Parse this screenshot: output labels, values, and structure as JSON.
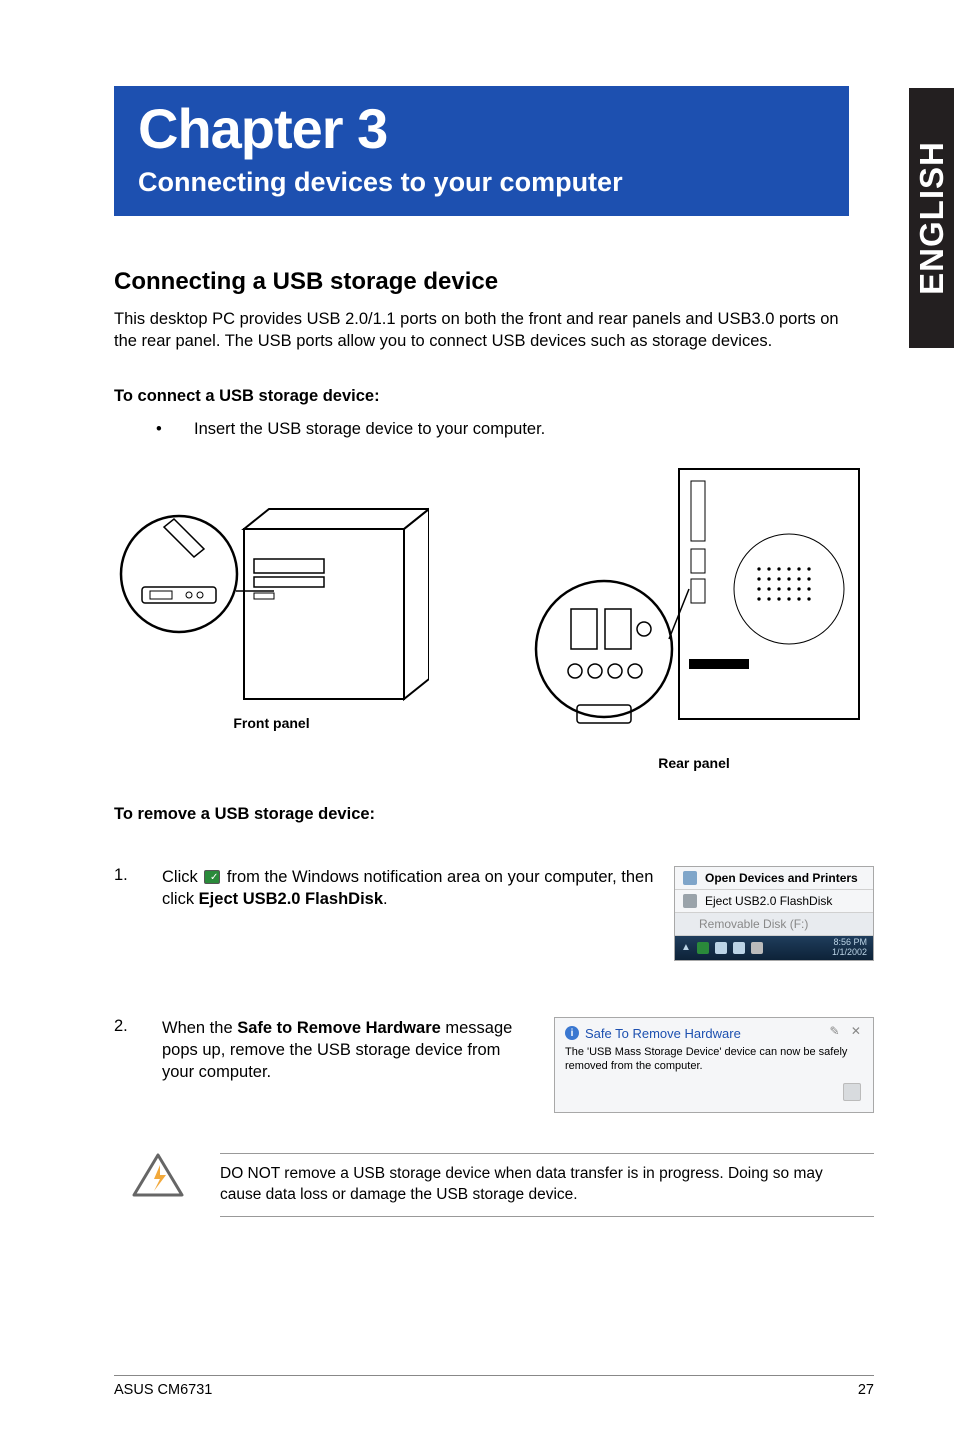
{
  "side_tab": "ENGLISH",
  "chapter": {
    "title": "Chapter 3",
    "subtitle": "Connecting devices to your computer"
  },
  "section_heading": "Connecting a USB storage device",
  "intro_text": "This desktop PC provides USB 2.0/1.1 ports on both the front and rear panels and USB3.0 ports on the rear panel. The USB ports allow you to connect USB devices such as storage devices.",
  "connect_heading": "To connect a USB storage device:",
  "connect_bullet": "Insert the USB storage device to your computer.",
  "captions": {
    "front": "Front panel",
    "rear": "Rear panel"
  },
  "remove_heading": "To remove a USB storage device:",
  "step1": {
    "num": "1.",
    "pre": "Click ",
    "mid": " from the Windows notification area on your computer, then click ",
    "bold": "Eject USB2.0 FlashDisk",
    "post": "."
  },
  "step2": {
    "num": "2.",
    "pre": "When the ",
    "bold": "Safe to Remove Hardware",
    "post": " message pops up, remove the USB storage device from your computer."
  },
  "eject_menu": {
    "row1": "Open Devices and Printers",
    "row2": "Eject USB2.0 FlashDisk",
    "row3": "Removable Disk (F:)",
    "clock_time": "8:56 PM",
    "clock_date": "1/1/2002"
  },
  "safe_remove": {
    "title": "Safe To Remove Hardware",
    "body": "The 'USB Mass Storage Device' device can now be safely removed from the computer.",
    "close": "✎  ✕"
  },
  "warning": "DO NOT remove a USB storage device when data transfer is in progress. Doing so may cause data loss or damage the USB storage device.",
  "footer": {
    "left": "ASUS CM6731",
    "right": "27"
  }
}
